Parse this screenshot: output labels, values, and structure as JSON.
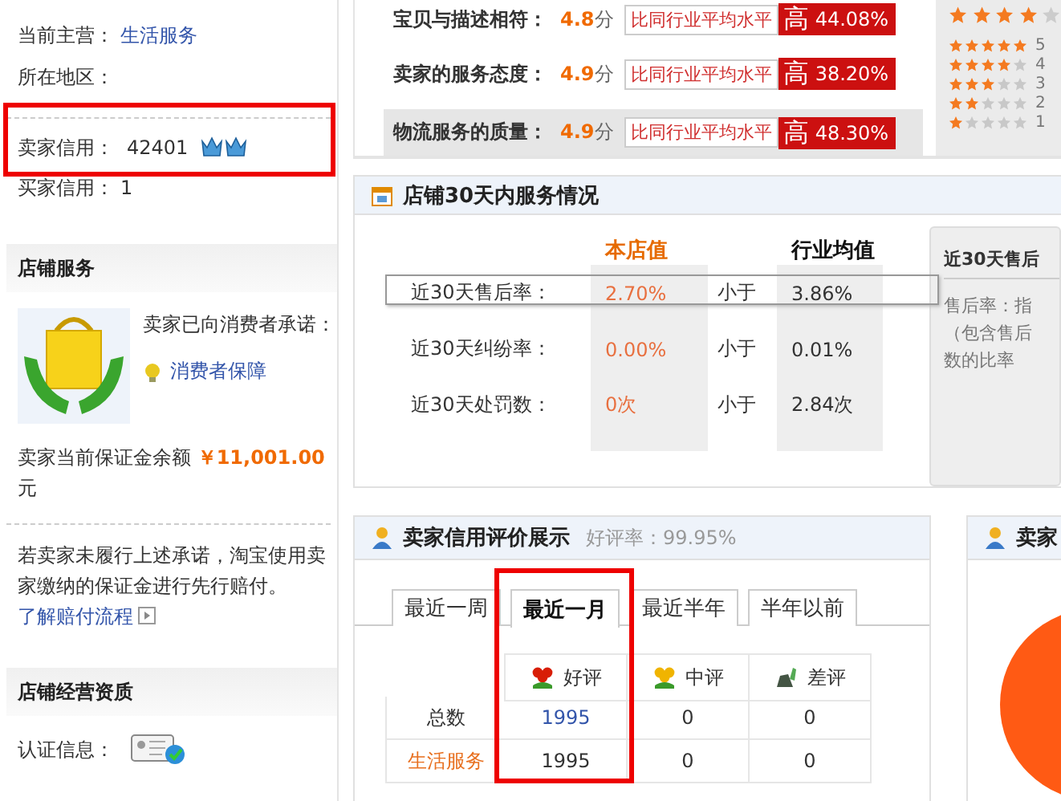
{
  "seller_info": {
    "main_business_label": "当前主营：",
    "main_business": "生活服务",
    "region_label": "所在地区：",
    "seller_credit_label": "卖家信用：",
    "seller_credit": "42401",
    "seller_credit_highlighted": true,
    "buyer_credit_label": "买家信用：",
    "buyer_credit": "1"
  },
  "shop_service": {
    "title": "店铺服务",
    "promise": "卖家已向消费者承诺：",
    "guarantee_link": "消费者保障",
    "deposit_label": "卖家当前保证金余额",
    "deposit_amount": "￥11,001.00",
    "deposit_unit": "元",
    "note": "若卖家未履行上述承诺，淘宝使用卖家缴纳的保证金进行先行赔付。",
    "note_link": "了解赔付流程"
  },
  "qualification": {
    "title": "店铺经营资质",
    "cert_label": "认证信息："
  },
  "ratings": [
    {
      "label": "宝贝与描述相符：",
      "score": "4.8",
      "unit": "分",
      "compare": "比同行业平均水平",
      "level_word": "高",
      "percent": "44.08%",
      "selected": false
    },
    {
      "label": "卖家的服务态度：",
      "score": "4.9",
      "unit": "分",
      "compare": "比同行业平均水平",
      "level_word": "高",
      "percent": "38.20%",
      "selected": false
    },
    {
      "label": "物流服务的质量：",
      "score": "4.9",
      "unit": "分",
      "compare": "比同行业平均水平",
      "level_word": "高",
      "percent": "48.30%",
      "selected": true
    }
  ],
  "star_summary": {
    "stars": 4,
    "rows": [
      {
        "stars": 5,
        "label": "5"
      },
      {
        "stars": 4,
        "label": "4"
      },
      {
        "stars": 3,
        "label": "3"
      },
      {
        "stars": 2,
        "label": "2"
      },
      {
        "stars": 1,
        "label": "1"
      }
    ]
  },
  "service_30d": {
    "title": "店铺30天内服务情况",
    "col_store": "本店值",
    "col_industry": "行业均值",
    "rows": [
      {
        "label": "近30天售后率：",
        "store": "2.70%",
        "relation": "小于",
        "industry": "3.86%",
        "selected": true
      },
      {
        "label": "近30天纠纷率：",
        "store": "0.00%",
        "relation": "小于",
        "industry": "0.01%",
        "selected": false
      },
      {
        "label": "近30天处罚数：",
        "store": "0次",
        "relation": "小于",
        "industry": "2.84次",
        "selected": false
      }
    ],
    "info": {
      "title": "近30天售后",
      "lines": [
        "售后率：指",
        "（包含售后",
        "数的比率"
      ]
    }
  },
  "credit_display": {
    "title": "卖家信用评价展示",
    "rate": "好评率：99.95%",
    "tabs": [
      {
        "label": "最近一周",
        "selected": false
      },
      {
        "label": "最近一月",
        "selected": true
      },
      {
        "label": "最近半年",
        "selected": false
      },
      {
        "label": "半年以前",
        "selected": false
      }
    ],
    "columns": [
      {
        "label": "好评",
        "kind": "good",
        "highlighted": true
      },
      {
        "label": "中评",
        "kind": "neutral",
        "highlighted": false
      },
      {
        "label": "差评",
        "kind": "bad",
        "highlighted": false
      }
    ],
    "rows": [
      {
        "label": "总数",
        "kind": "total",
        "cells": [
          "1995",
          "0",
          "0"
        ]
      },
      {
        "label": "生活服务",
        "kind": "category",
        "cells": [
          "1995",
          "0",
          "0"
        ]
      }
    ]
  },
  "side_panel": {
    "title": "卖家"
  }
}
